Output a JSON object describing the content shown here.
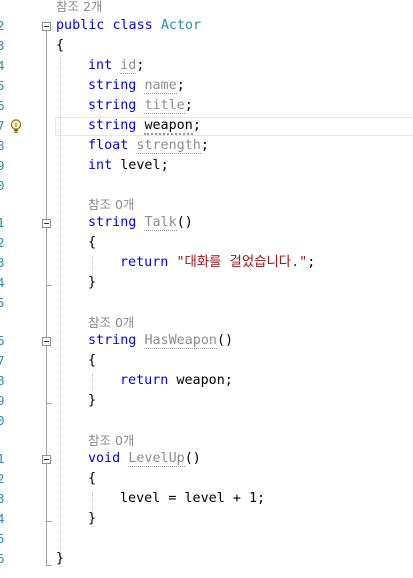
{
  "colors": {
    "keyword": "#0000ff",
    "type": "#2b91af",
    "string": "#a31515",
    "codelens": "#8b8b8b",
    "background": "#ffffff"
  },
  "line_numbers": [
    "2",
    "3",
    "4",
    "5",
    "6",
    "7",
    "8",
    "9",
    "0",
    "1",
    "2",
    "3",
    "4",
    "5",
    "6",
    "7",
    "8",
    "9",
    "0",
    "1",
    "2",
    "3",
    "4",
    "5",
    "6"
  ],
  "codelens": {
    "class_refs": "참조 2개",
    "talk_refs": "참조 0개",
    "hasweapon_refs": "참조 0개",
    "levelup_refs": "참조 0개"
  },
  "code": {
    "l1": {
      "kw1": "public",
      "kw2": "class",
      "name": "Actor"
    },
    "l2": "{",
    "l3": {
      "kw": "int",
      "name": "id",
      "semi": ";"
    },
    "l4": {
      "kw": "string",
      "name": "name",
      "semi": ";"
    },
    "l5": {
      "kw": "string",
      "name": "title",
      "semi": ";"
    },
    "l6": {
      "kw": "string",
      "name": "weapon",
      "semi": ";"
    },
    "l7": {
      "kw": "float",
      "name": "strength",
      "semi": ";"
    },
    "l8": {
      "kw": "int",
      "name": "level",
      "semi": ";"
    },
    "l10": {
      "kw": "string",
      "name": "Talk",
      "rest": "()"
    },
    "l11": "{",
    "l12": {
      "kw": "return",
      "str": "\"대화를 걸었습니다.\"",
      "semi": ";"
    },
    "l13": "}",
    "l15": {
      "kw": "string",
      "name": "HasWeapon",
      "rest": "()"
    },
    "l16": "{",
    "l17": {
      "kw": "return",
      "rest": " weapon;"
    },
    "l18": "}",
    "l20": {
      "kw": "void",
      "name": "LevelUp",
      "rest": "()"
    },
    "l21": "{",
    "l22": {
      "a": "level",
      "op": " = level + 1;"
    },
    "l23": "}",
    "l25": "}"
  },
  "icons": {
    "quick_actions": "lightbulb-icon",
    "fold": "collapse-minus-icon"
  }
}
